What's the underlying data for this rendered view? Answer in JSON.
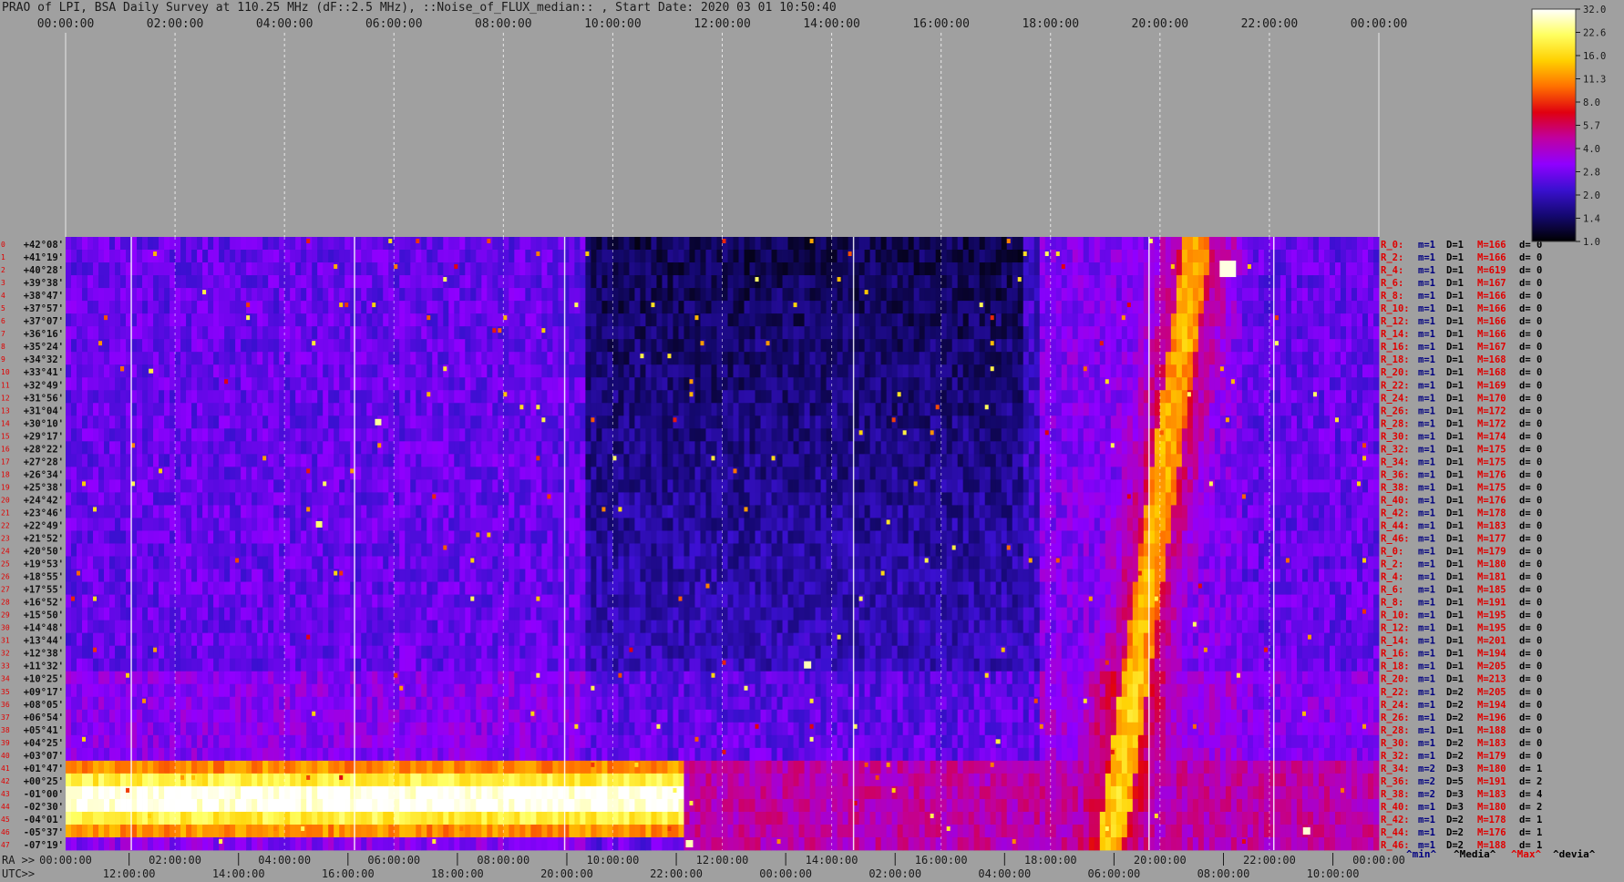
{
  "title": "PRAO of LPI, BSA Daily Survey at 110.25 MHz (dF::2.5 MHz), ::Noise_of_FLUX_median:: , Start Date: 2020 03 01 10:50:40",
  "chart_data": {
    "type": "heatmap",
    "top_time_ticks": [
      "00:00:00",
      "02:00:00",
      "04:00:00",
      "06:00:00",
      "08:00:00",
      "10:00:00",
      "12:00:00",
      "14:00:00",
      "16:00:00",
      "18:00:00",
      "20:00:00",
      "22:00:00",
      "00:00:00"
    ],
    "bottom_axis_prefix_ra": "RA >>",
    "bottom_axis_prefix_utc": "UTC>>",
    "ra_ticks": [
      "00:00:00",
      "02:00:00",
      "04:00:00",
      "06:00:00",
      "08:00:00",
      "10:00:00",
      "12:00:00",
      "14:00:00",
      "16:00:00",
      "18:00:00",
      "20:00:00",
      "22:00:00",
      "00:00:00"
    ],
    "utc_ticks": [
      "12:00:00",
      "14:00:00",
      "16:00:00",
      "18:00:00",
      "20:00:00",
      "22:00:00",
      "00:00:00",
      "02:00:00",
      "04:00:00",
      "06:00:00",
      "08:00:00",
      "10:00:00"
    ],
    "colorbar": {
      "ticks": [
        "32.0",
        "22.6",
        "16.0",
        "11.3",
        "8.0",
        "5.7",
        "4.0",
        "2.8",
        "2.0",
        "1.4",
        "1.0"
      ],
      "scale": "log",
      "range": [
        1.0,
        32.0
      ],
      "colors": [
        "#ffffff",
        "#ffff60",
        "#ffd000",
        "#ff7000",
        "#e00010",
        "#c000a0",
        "#9000ff",
        "#3a10d0",
        "#140870",
        "#000000"
      ]
    },
    "declinations": [
      "+42°08'",
      "+41°19'",
      "+40°28'",
      "+39°38'",
      "+38°47'",
      "+37°57'",
      "+37°07'",
      "+36°16'",
      "+35°24'",
      "+34°32'",
      "+33°41'",
      "+32°49'",
      "+31°56'",
      "+31°04'",
      "+30°10'",
      "+29°17'",
      "+28°22'",
      "+27°28'",
      "+26°34'",
      "+25°38'",
      "+24°42'",
      "+23°46'",
      "+22°49'",
      "+21°52'",
      "+20°50'",
      "+19°53'",
      "+18°55'",
      "+17°55'",
      "+16°52'",
      "+15°50'",
      "+14°48'",
      "+13°44'",
      "+12°38'",
      "+11°32'",
      "+10°25'",
      "+09°17'",
      "+08°05'",
      "+06°54'",
      "+05°41'",
      "+04°25'",
      "+03°07'",
      "+01°47'",
      "+00°25'",
      "-01°00'",
      "-02°30'",
      "-04°01'",
      "-05°37'",
      "-07°19'"
    ],
    "beam_numbers": [
      "0",
      "1",
      "2",
      "3",
      "4",
      "5",
      "6",
      "7",
      "8",
      "9",
      "10",
      "11",
      "12",
      "13",
      "14",
      "15",
      "16",
      "17",
      "18",
      "19",
      "20",
      "21",
      "22",
      "23",
      "24",
      "25",
      "26",
      "27",
      "28",
      "29",
      "30",
      "31",
      "32",
      "33",
      "34",
      "35",
      "36",
      "37",
      "38",
      "39",
      "40",
      "41",
      "42",
      "43",
      "44",
      "45",
      "46",
      "47"
    ],
    "row_stats": [
      {
        "r": "R_0:",
        "m": "m=1",
        "D": "D=1",
        "M": "M=166",
        "d": "d= 0"
      },
      {
        "r": "R_2:",
        "m": "m=1",
        "D": "D=1",
        "M": "M=166",
        "d": "d= 0"
      },
      {
        "r": "R_4:",
        "m": "m=1",
        "D": "D=1",
        "M": "M=619",
        "d": "d= 0"
      },
      {
        "r": "R_6:",
        "m": "m=1",
        "D": "D=1",
        "M": "M=167",
        "d": "d= 0"
      },
      {
        "r": "R_8:",
        "m": "m=1",
        "D": "D=1",
        "M": "M=166",
        "d": "d= 0"
      },
      {
        "r": "R_10:",
        "m": "m=1",
        "D": "D=1",
        "M": "M=166",
        "d": "d= 0"
      },
      {
        "r": "R_12:",
        "m": "m=1",
        "D": "D=1",
        "M": "M=166",
        "d": "d= 0"
      },
      {
        "r": "R_14:",
        "m": "m=1",
        "D": "D=1",
        "M": "M=166",
        "d": "d= 0"
      },
      {
        "r": "R_16:",
        "m": "m=1",
        "D": "D=1",
        "M": "M=167",
        "d": "d= 0"
      },
      {
        "r": "R_18:",
        "m": "m=1",
        "D": "D=1",
        "M": "M=168",
        "d": "d= 0"
      },
      {
        "r": "R_20:",
        "m": "m=1",
        "D": "D=1",
        "M": "M=168",
        "d": "d= 0"
      },
      {
        "r": "R_22:",
        "m": "m=1",
        "D": "D=1",
        "M": "M=169",
        "d": "d= 0"
      },
      {
        "r": "R_24:",
        "m": "m=1",
        "D": "D=1",
        "M": "M=170",
        "d": "d= 0"
      },
      {
        "r": "R_26:",
        "m": "m=1",
        "D": "D=1",
        "M": "M=172",
        "d": "d= 0"
      },
      {
        "r": "R_28:",
        "m": "m=1",
        "D": "D=1",
        "M": "M=172",
        "d": "d= 0"
      },
      {
        "r": "R_30:",
        "m": "m=1",
        "D": "D=1",
        "M": "M=174",
        "d": "d= 0"
      },
      {
        "r": "R_32:",
        "m": "m=1",
        "D": "D=1",
        "M": "M=175",
        "d": "d= 0"
      },
      {
        "r": "R_34:",
        "m": "m=1",
        "D": "D=1",
        "M": "M=175",
        "d": "d= 0"
      },
      {
        "r": "R_36:",
        "m": "m=1",
        "D": "D=1",
        "M": "M=176",
        "d": "d= 0"
      },
      {
        "r": "R_38:",
        "m": "m=1",
        "D": "D=1",
        "M": "M=175",
        "d": "d= 0"
      },
      {
        "r": "R_40:",
        "m": "m=1",
        "D": "D=1",
        "M": "M=176",
        "d": "d= 0"
      },
      {
        "r": "R_42:",
        "m": "m=1",
        "D": "D=1",
        "M": "M=178",
        "d": "d= 0"
      },
      {
        "r": "R_44:",
        "m": "m=1",
        "D": "D=1",
        "M": "M=183",
        "d": "d= 0"
      },
      {
        "r": "R_46:",
        "m": "m=1",
        "D": "D=1",
        "M": "M=177",
        "d": "d= 0"
      },
      {
        "r": "R_0:",
        "m": "m=1",
        "D": "D=1",
        "M": "M=179",
        "d": "d= 0"
      },
      {
        "r": "R_2:",
        "m": "m=1",
        "D": "D=1",
        "M": "M=180",
        "d": "d= 0"
      },
      {
        "r": "R_4:",
        "m": "m=1",
        "D": "D=1",
        "M": "M=181",
        "d": "d= 0"
      },
      {
        "r": "R_6:",
        "m": "m=1",
        "D": "D=1",
        "M": "M=185",
        "d": "d= 0"
      },
      {
        "r": "R_8:",
        "m": "m=1",
        "D": "D=1",
        "M": "M=191",
        "d": "d= 0"
      },
      {
        "r": "R_10:",
        "m": "m=1",
        "D": "D=1",
        "M": "M=195",
        "d": "d= 0"
      },
      {
        "r": "R_12:",
        "m": "m=1",
        "D": "D=1",
        "M": "M=195",
        "d": "d= 0"
      },
      {
        "r": "R_14:",
        "m": "m=1",
        "D": "D=1",
        "M": "M=201",
        "d": "d= 0"
      },
      {
        "r": "R_16:",
        "m": "m=1",
        "D": "D=1",
        "M": "M=194",
        "d": "d= 0"
      },
      {
        "r": "R_18:",
        "m": "m=1",
        "D": "D=1",
        "M": "M=205",
        "d": "d= 0"
      },
      {
        "r": "R_20:",
        "m": "m=1",
        "D": "D=1",
        "M": "M=213",
        "d": "d= 0"
      },
      {
        "r": "R_22:",
        "m": "m=1",
        "D": "D=2",
        "M": "M=205",
        "d": "d= 0"
      },
      {
        "r": "R_24:",
        "m": "m=1",
        "D": "D=2",
        "M": "M=194",
        "d": "d= 0"
      },
      {
        "r": "R_26:",
        "m": "m=1",
        "D": "D=2",
        "M": "M=196",
        "d": "d= 0"
      },
      {
        "r": "R_28:",
        "m": "m=1",
        "D": "D=1",
        "M": "M=188",
        "d": "d= 0"
      },
      {
        "r": "R_30:",
        "m": "m=1",
        "D": "D=2",
        "M": "M=183",
        "d": "d= 0"
      },
      {
        "r": "R_32:",
        "m": "m=1",
        "D": "D=2",
        "M": "M=179",
        "d": "d= 0"
      },
      {
        "r": "R_34:",
        "m": "m=2",
        "D": "D=3",
        "M": "M=180",
        "d": "d= 1"
      },
      {
        "r": "R_36:",
        "m": "m=2",
        "D": "D=5",
        "M": "M=191",
        "d": "d= 2"
      },
      {
        "r": "R_38:",
        "m": "m=2",
        "D": "D=3",
        "M": "M=183",
        "d": "d= 4"
      },
      {
        "r": "R_40:",
        "m": "m=1",
        "D": "D=3",
        "M": "M=180",
        "d": "d= 2"
      },
      {
        "r": "R_42:",
        "m": "m=1",
        "D": "D=2",
        "M": "M=178",
        "d": "d= 1"
      },
      {
        "r": "R_44:",
        "m": "m=1",
        "D": "D=2",
        "M": "M=176",
        "d": "d= 1"
      },
      {
        "r": "R_46:",
        "m": "m=1",
        "D": "D=2",
        "M": "M=188",
        "d": "d= 1"
      }
    ],
    "legend": {
      "min": "^min^",
      "median": "^Media^",
      "max": "^Max^",
      "deviation": "^devia^"
    },
    "stat_colors": {
      "r": "#e00000",
      "m": "#000080",
      "D": "#000000",
      "M": "#e00000",
      "d": "#000000"
    }
  }
}
